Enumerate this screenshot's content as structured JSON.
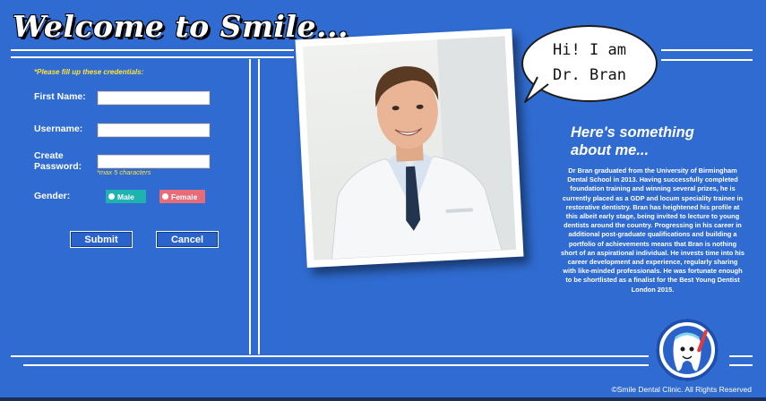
{
  "header": {
    "title": "Welcome to Smile..."
  },
  "form": {
    "note": "*Please fill up these credentials:",
    "first_name_label": "First Name:",
    "username_label": "Username:",
    "create_password_label_1": "Create",
    "create_password_label_2": "Password:",
    "password_hint": "*max 5 characters",
    "gender_label": "Gender:",
    "male_label": "Male",
    "female_label": "Female",
    "first_name_value": "",
    "username_value": "",
    "password_value": "",
    "submit_label": "Submit",
    "cancel_label": "Cancel"
  },
  "profile": {
    "bubble_line1": "Hi! I am",
    "bubble_line2": "Dr. Bran",
    "heading_line1": "Here's something",
    "heading_line2": "about me...",
    "bio": "Dr Bran graduated from the University of Birmingham Dental School in 2013. Having successfully completed foundation training and winning several prizes, he is currently placed as a GDP and locum speciality trainee in restorative dentistry. Bran has heightened his profile at this albeit early stage, being invited to lecture to young dentists around the country. Progressing in his career in additional post-graduate qualifications and building a portfolio of achievements means that Bran is nothing short of an aspirational individual. He invests time into his career development and experience, regularly sharing with like-minded professionals. He was fortunate enough to be shortlisted as a finalist for the Best Young Dentist London 2015."
  },
  "footer": {
    "copyright": "©Smile Dental Clinic. All Rights Reserved"
  },
  "colors": {
    "background": "#2f6bd0",
    "note": "#ffe338",
    "male": "#1fb3b0",
    "female": "#e86b78",
    "hint": "#ffe338"
  },
  "icons": {
    "bubble_dot": "speech-bubble-icon",
    "logo": "tooth-mascot-icon"
  }
}
